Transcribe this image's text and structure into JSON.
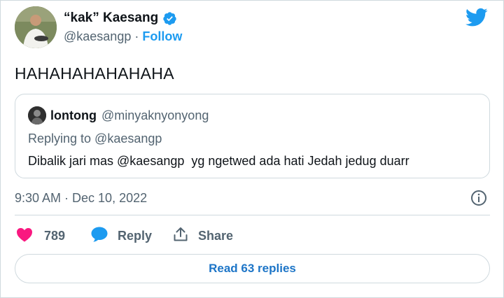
{
  "author": {
    "display_name": "“kak” Kaesang",
    "handle": "@kaesangp",
    "separator": "·",
    "follow_label": "Follow"
  },
  "tweet": {
    "text": "HAHAHAHAHAHAHA",
    "timestamp": "9:30 AM · Dec 10, 2022"
  },
  "quoted": {
    "name": "lontong",
    "handle": "@minyaknyonyong",
    "replying_to": "Replying to @kaesangp",
    "text": "Dibalik jari mas @kaesangp  yg ngetwed ada hati Jedah jedug duarr"
  },
  "actions": {
    "like_count": "789",
    "reply_label": "Reply",
    "share_label": "Share"
  },
  "read_replies_label": "Read 63 replies",
  "colors": {
    "accent": "#1d9bf0",
    "like": "#f91880",
    "muted": "#536471",
    "border": "#cfd9de"
  },
  "icons": [
    "verified-badge-icon",
    "twitter-bird-icon",
    "info-icon",
    "heart-icon",
    "reply-bubble-icon",
    "share-icon"
  ]
}
